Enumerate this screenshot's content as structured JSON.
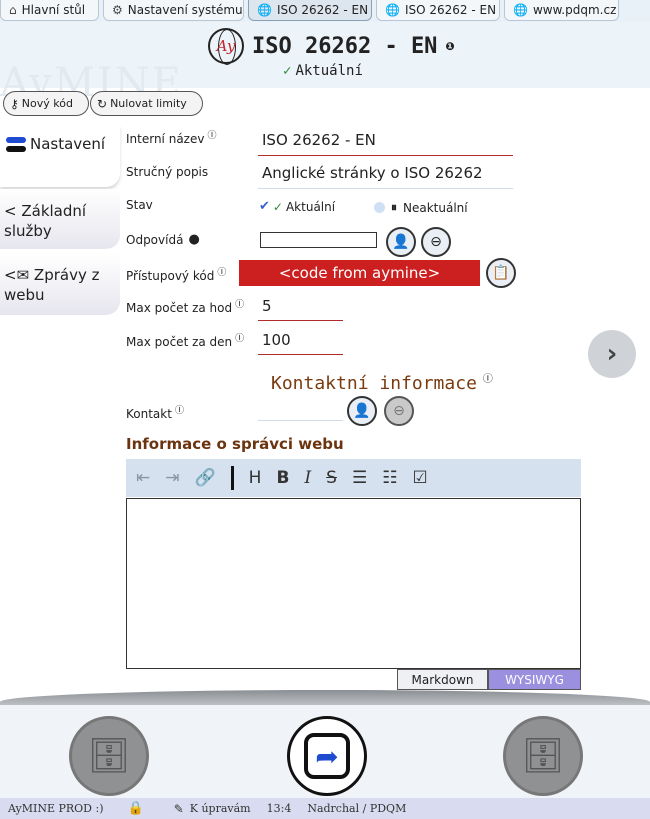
{
  "tabs": [
    {
      "label": "Hlavní stůl",
      "icon": "home-icon"
    },
    {
      "label": "Nastavení systému",
      "icon": "settings-icon"
    },
    {
      "label": "ISO 26262 - EN",
      "icon": "web-icon",
      "active": true
    },
    {
      "label": "ISO 26262 - EN",
      "icon": "web-icon"
    },
    {
      "label": "www.pdqm.cz",
      "icon": "web-icon"
    }
  ],
  "header": {
    "logo_text": "Ay",
    "title": "ISO 26262 - EN",
    "info_mark": "❶",
    "status": "Aktuální",
    "watermark": "AyMINE"
  },
  "actions": {
    "new_code": "Nový kód",
    "reset_limits": "Nulovat limity"
  },
  "sidebar": {
    "items": [
      {
        "label": "Nastavení"
      },
      {
        "label": "Základní služby"
      },
      {
        "label": "Zprávy z webu"
      }
    ]
  },
  "form": {
    "internal_name_label": "Interní název",
    "internal_name_value": "ISO 26262 - EN",
    "short_desc_label": "Stručný popis",
    "short_desc_value": "Anglické stránky o ISO 26262",
    "state_label": "Stav",
    "state_current": "Aktuální",
    "state_obsolete": "Neaktuální",
    "responsible_label": "Odpovídá",
    "responsible_value": "",
    "access_code_label": "Přístupový kód",
    "access_code_value": "<code from aymine>",
    "max_hour_label": "Max počet za hod",
    "max_hour_value": "5",
    "max_day_label": "Max počet za den",
    "max_day_value": "100",
    "contact_section": "Kontaktní informace",
    "contact_label": "Kontakt",
    "webmaster_section": "Informace o správci webu",
    "info_mark": "Ⓘ"
  },
  "editor": {
    "mode_markdown": "Markdown",
    "mode_wysiwyg": "WYSIWYG",
    "content": ""
  },
  "status_bar": {
    "instance": "AyMINE PROD :)",
    "edit_state": "K úpravám",
    "time": "13:4",
    "user": "Nadrchal / PDQM"
  },
  "colors": {
    "accent_red": "#b22b2b",
    "access_code_bg": "#cc1f1f",
    "section_brown": "#7a3b10",
    "wysiwyg_active": "#9b8fe0"
  }
}
